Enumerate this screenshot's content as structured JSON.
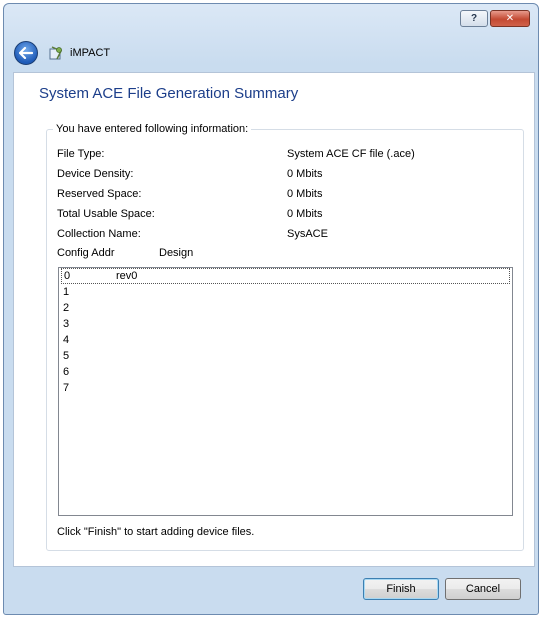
{
  "window": {
    "help_label": "?",
    "close_label": "✕"
  },
  "nav": {
    "app_title": "iMPACT"
  },
  "page": {
    "title": "System ACE File Generation Summary"
  },
  "group": {
    "legend": "You have entered following information:"
  },
  "info": [
    {
      "label": "File Type:",
      "value": "System ACE CF file (.ace)"
    },
    {
      "label": "Device Density:",
      "value": "0 Mbits"
    },
    {
      "label": "Reserved Space:",
      "value": "0 Mbits"
    },
    {
      "label": "Total Usable Space:",
      "value": "0 Mbits"
    },
    {
      "label": "Collection Name:",
      "value": "SysACE"
    }
  ],
  "table": {
    "columns": [
      "Config Addr",
      "Design"
    ],
    "rows": [
      {
        "addr": "0",
        "design": "rev0",
        "selected": true
      },
      {
        "addr": "1",
        "design": ""
      },
      {
        "addr": "2",
        "design": ""
      },
      {
        "addr": "3",
        "design": ""
      },
      {
        "addr": "4",
        "design": ""
      },
      {
        "addr": "5",
        "design": ""
      },
      {
        "addr": "6",
        "design": ""
      },
      {
        "addr": "7",
        "design": ""
      }
    ]
  },
  "hint": "Click \"Finish\" to start adding device files.",
  "buttons": {
    "finish": "Finish",
    "cancel": "Cancel"
  },
  "colors": {
    "title": "#1c3e8a",
    "frame": "#c9dcef",
    "close": "#c44a33"
  },
  "icons": {
    "back": "back-arrow-icon",
    "app": "impact-app-icon",
    "help": "help-icon",
    "close": "close-icon"
  }
}
